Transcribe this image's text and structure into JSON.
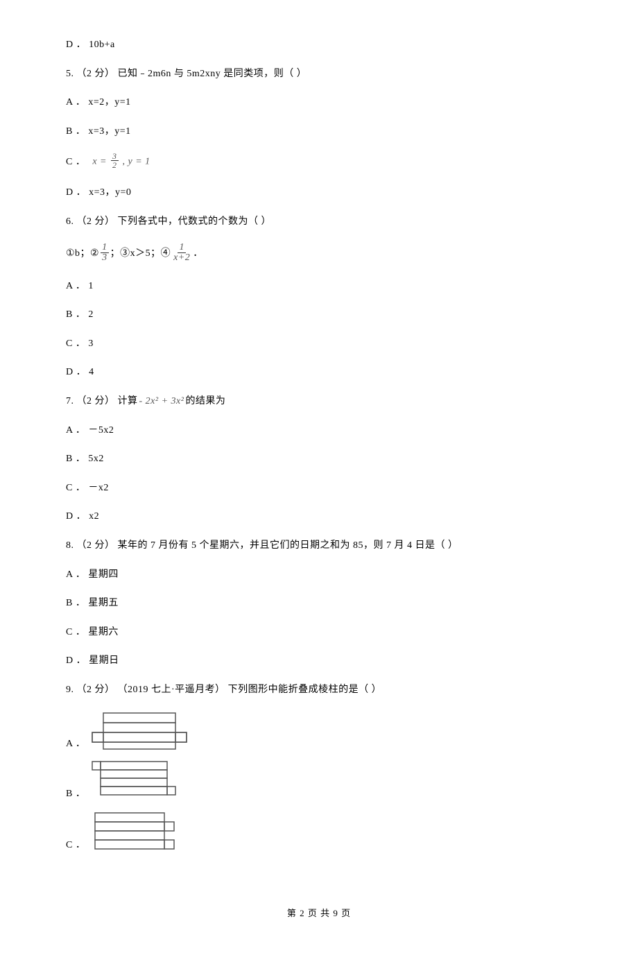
{
  "q4d": "D ． 10b+a",
  "q5": {
    "stem": "5.  （2 分）  已知﹣2m6n 与 5m2xny 是同类项，则（      ）",
    "a": "A ． x=2，y=1",
    "b": "B ． x=3，y=1",
    "c_prefix": "C ．",
    "c_math_pre": "x =",
    "c_math_post": ", y = 1",
    "d": "D ． x=3，y=0"
  },
  "q6": {
    "stem": "6.  （2 分）  下列各式中，代数式的个数为（      ）",
    "list_1": "①b；②",
    "list_2": "；③x＞5；④",
    "list_3": "  ．",
    "a": "A ． 1",
    "b": "B ． 2",
    "c": "C ． 3",
    "d": "D ． 4"
  },
  "q7": {
    "stem_pre": "7.  （2 分）  计算",
    "stem_math": "- 2x² + 3x²",
    "stem_post": "的结果为",
    "a": "A ． －5x2",
    "b": "B ． 5x2",
    "c": "C ． －x2",
    "d": "D ． x2"
  },
  "q8": {
    "stem": "8.  （2 分）  某年的 7 月份有 5 个星期六，并且它们的日期之和为 85，则 7 月 4 日是（      ）",
    "a": "A ． 星期四",
    "b": "B ． 星期五",
    "c": "C ． 星期六",
    "d": "D ． 星期日"
  },
  "q9": {
    "stem": "9.  （2 分） （2019 七上·平遥月考） 下列图形中能折叠成棱柱的是（      ）",
    "a": "A ．",
    "b": "B ．",
    "c": "C ．"
  },
  "footer": "第 2 页 共 9 页"
}
